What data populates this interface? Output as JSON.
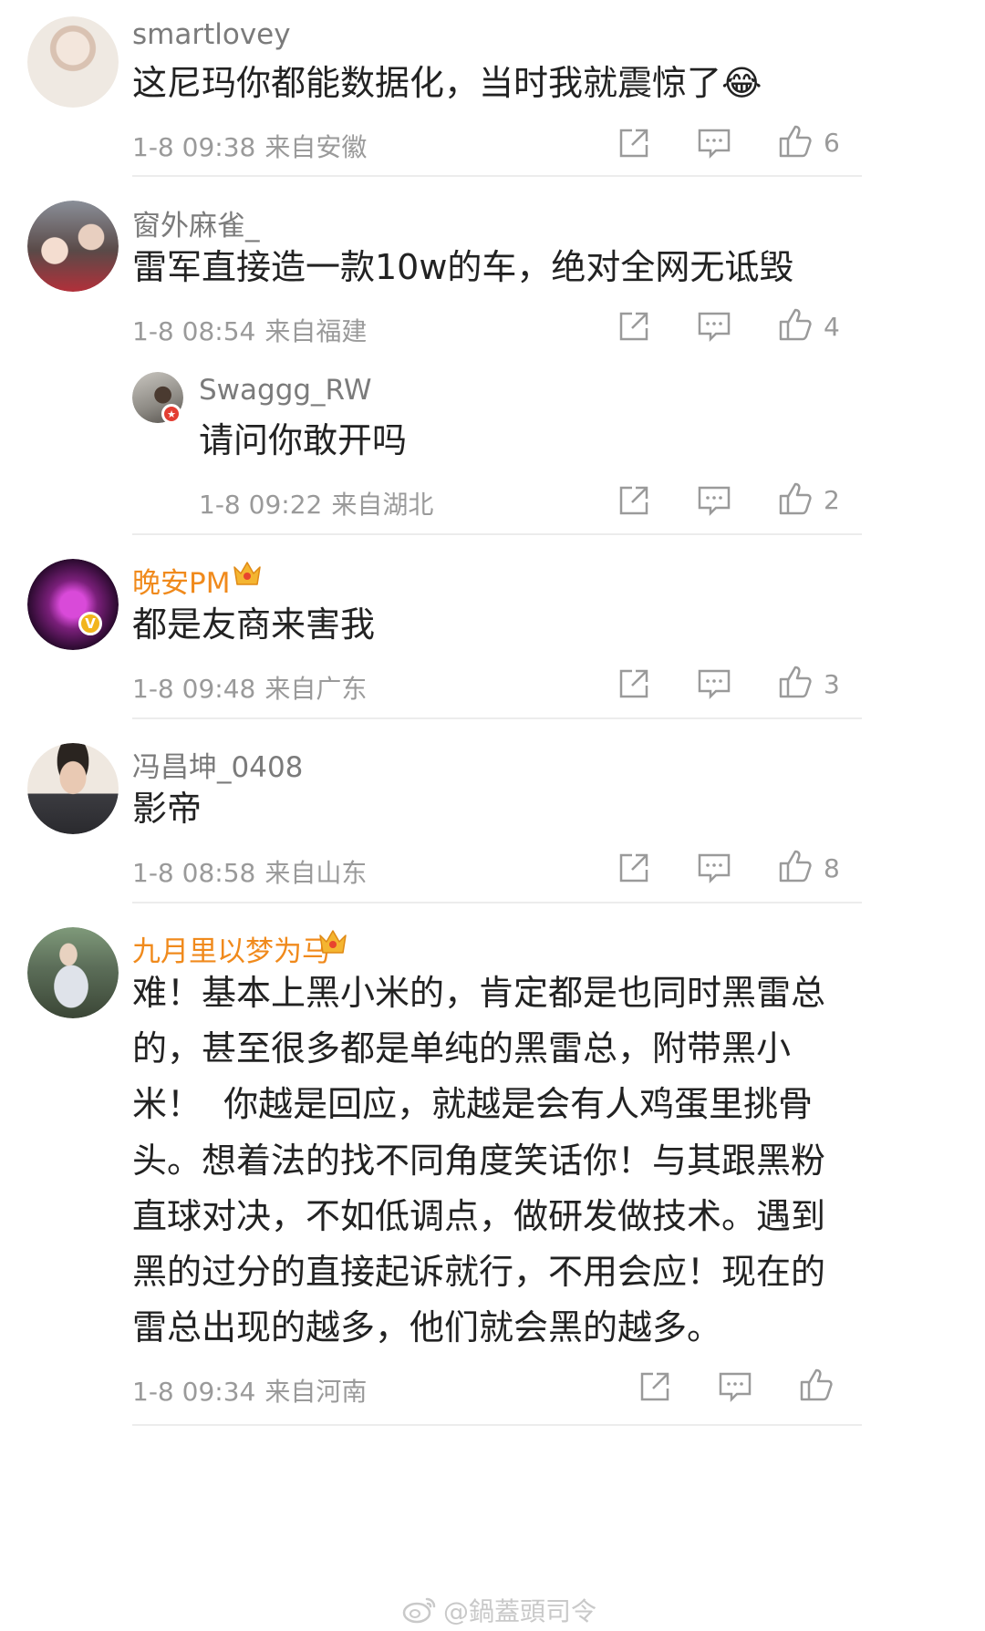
{
  "comments": [
    {
      "username": "smartlovey",
      "text_lines": [
        "这尼玛你都能数据化，当时我就震惊了😂"
      ],
      "date": "1-8 09:38",
      "location": "来自安徽",
      "likes": "6"
    },
    {
      "username": "窗外麻雀_",
      "text_lines": [
        "雷军直接造一款10w的车，绝对全网无诋毁"
      ],
      "date": "1-8 08:54",
      "location": "来自福建",
      "likes": "4",
      "reply": {
        "username": "Swaggg_RW",
        "text_lines": [
          "请问你敢开吗"
        ],
        "date": "1-8 09:22",
        "location": "来自湖北",
        "likes": "2"
      }
    },
    {
      "username": "晚安PM",
      "text_lines": [
        "都是友商来害我"
      ],
      "date": "1-8 09:48",
      "location": "来自广东",
      "likes": "3"
    },
    {
      "username": "冯昌坤_0408",
      "text_lines": [
        "影帝"
      ],
      "date": "1-8 08:58",
      "location": "来自山东",
      "likes": "8"
    },
    {
      "username": "九月里以梦为马",
      "text_lines": [
        "难！基本上黑小米的，肯定都是也同时黑雷总",
        "的，甚至很多都是单纯的黑雷总，附带黑小",
        "米！  你越是回应，就越是会有人鸡蛋里挑骨",
        "头。想着法的找不同角度笑话你！与其跟黑粉",
        "直球对决，不如低调点，做研发做技术。遇到",
        "黑的过分的直接起诉就行，不用会应！现在的",
        "雷总出现的越多，他们就会黑的越多。"
      ],
      "date": "1-8 09:34",
      "location": "来自河南",
      "likes": ""
    }
  ],
  "watermark": "@鍋蓋頭司令",
  "colors": {
    "vip_name": "#f08a1c",
    "normal_name": "#7b7b7b",
    "icon": "#9a9a9a",
    "divider": "#ececec",
    "verified_badge": "#f2b51c",
    "red_badge": "#e33e33"
  }
}
